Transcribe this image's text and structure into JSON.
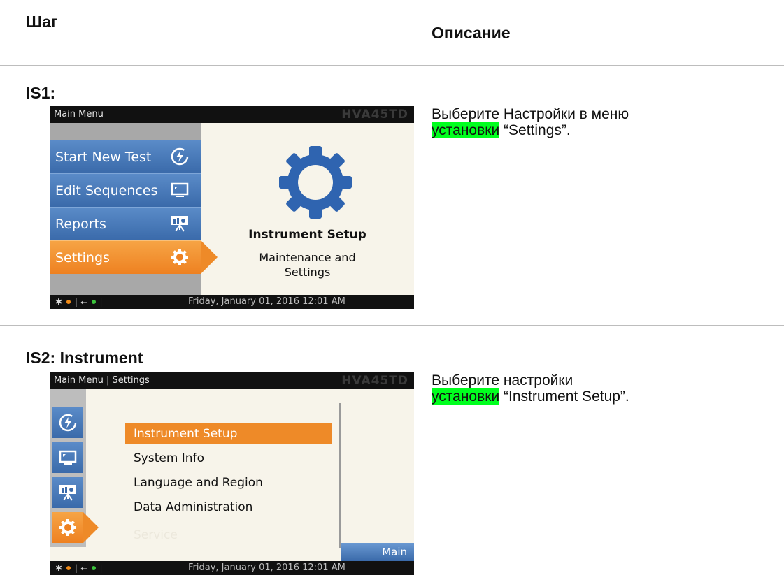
{
  "headers": {
    "step": "Шаг",
    "description": "Описание"
  },
  "steps": [
    {
      "label": "IS1:",
      "desc_before": "Выберите Настройки в меню ",
      "desc_highlight": "установки",
      "desc_after": " “Settings”.",
      "screen": {
        "title": "Main Menu",
        "brand": "HVA45TD",
        "menu": [
          "Start New Test",
          "Edit Sequences",
          "Reports",
          "Settings"
        ],
        "selected_index": 3,
        "panel_title": "Instrument Setup",
        "panel_subtitle_line1": "Maintenance and",
        "panel_subtitle_line2": "Settings",
        "status_datetime": "Friday, January 01, 2016 12:01 AM"
      }
    },
    {
      "label": "IS2: Instrument",
      "desc_before": "Выберите настройки ",
      "desc_highlight": "установки",
      "desc_after": " “Instrument Setup”.",
      "screen": {
        "title": "Main Menu | Settings",
        "brand": "HVA45TD",
        "list": [
          "Instrument Setup",
          "System Info",
          "Language and Region",
          "Data Administration",
          "Service"
        ],
        "selected_index": 0,
        "main_button": "Main",
        "status_datetime": "Friday, January 01, 2016 12:01 AM"
      }
    }
  ],
  "colors": {
    "highlight": "#00ff1e",
    "menu_blue": "#3a6aaa",
    "menu_orange": "#ee8121",
    "gear_blue": "#2f64b0"
  }
}
